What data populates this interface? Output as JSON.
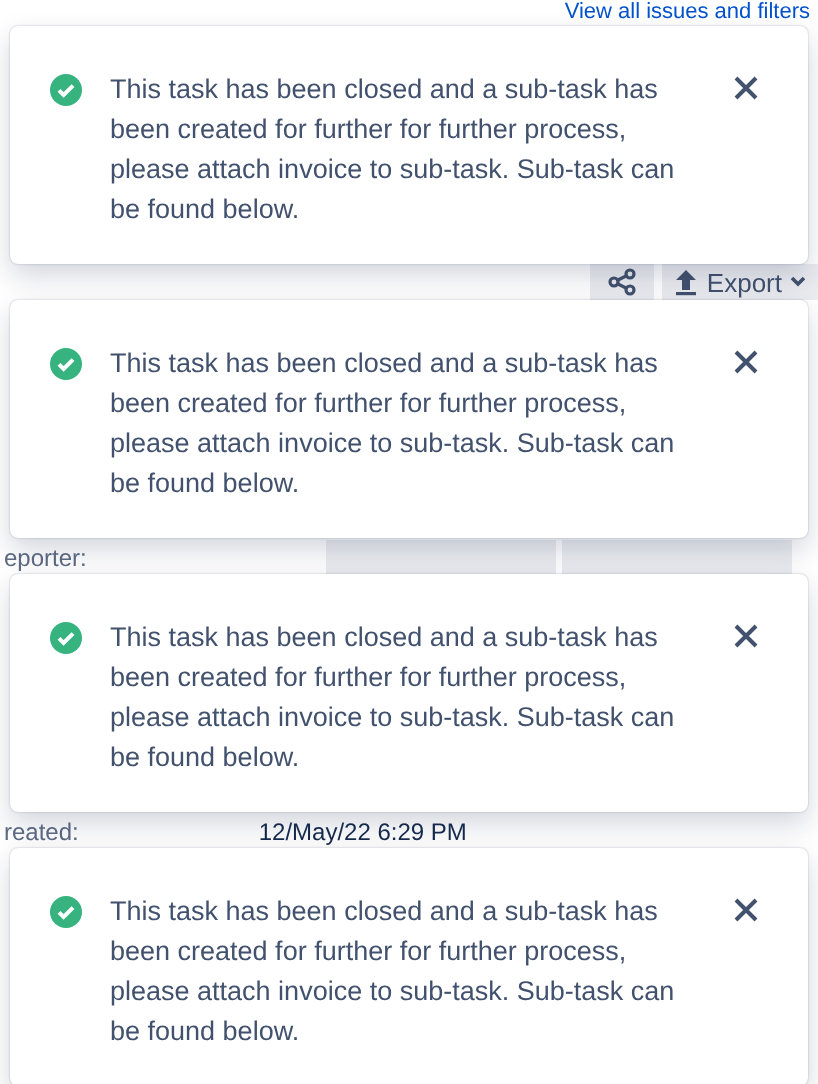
{
  "page": {
    "link": "View all issues and filters",
    "toolbar": {
      "export_button": "Export"
    },
    "reporter_label": "eporter:",
    "created_label": "reated:",
    "created_value": "12/May/22 6:29 PM"
  },
  "toasts": [
    {
      "kind": "success",
      "message": "This task has been closed and a sub-task has been created for further for further process, please attach invoice to sub-task. Sub-task can be found below.",
      "dismissible": true
    },
    {
      "kind": "success",
      "message": "This task has been closed and a sub-task has been created for further for further process, please attach invoice to sub-task. Sub-task can be found below.",
      "dismissible": true
    },
    {
      "kind": "success",
      "message": "This task has been closed and a sub-task has been created for further for further process, please attach invoice to sub-task. Sub-task can be found below.",
      "dismissible": true
    },
    {
      "kind": "success",
      "message": "This task has been closed and a sub-task has been created for further for further process, please attach invoice to sub-task. Sub-task can be found below.",
      "dismissible": true
    }
  ]
}
